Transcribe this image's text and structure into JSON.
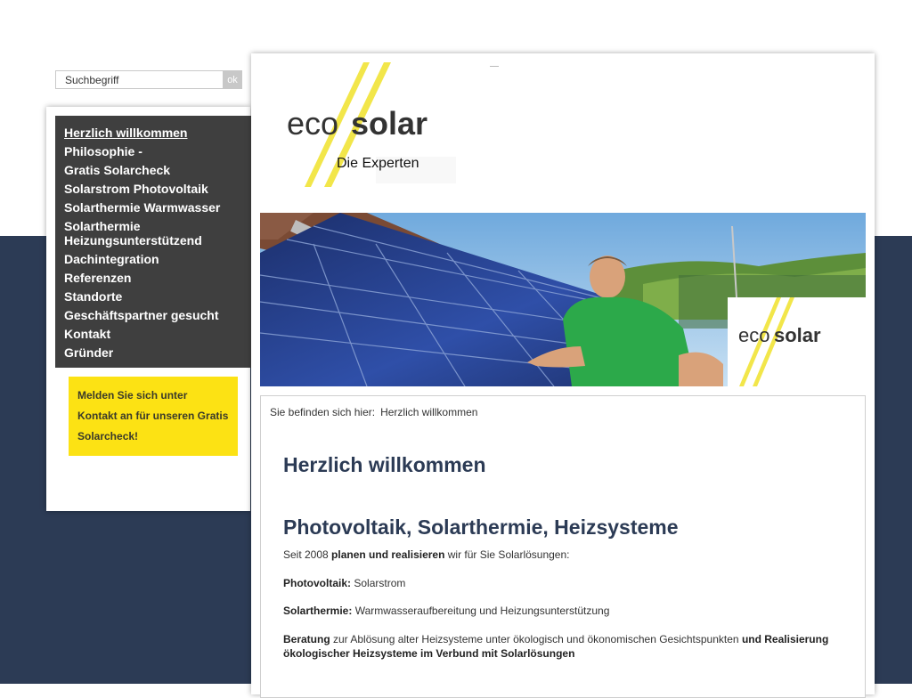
{
  "search": {
    "placeholder": "Suchbegriff",
    "button_label": "ok"
  },
  "nav": {
    "items": [
      {
        "label": "Herzlich willkommen",
        "active": true
      },
      {
        "label": "Philosophie -"
      },
      {
        "label": "Gratis Solarcheck"
      },
      {
        "label": "Solarstrom Photovoltaik"
      },
      {
        "label": "Solarthermie Warmwasser"
      },
      {
        "label": "Solarthermie Heizungsunterstützend"
      },
      {
        "label": "Dachintegration"
      },
      {
        "label": "Referenzen"
      },
      {
        "label": "Standorte"
      },
      {
        "label": "Geschäftspartner gesucht"
      },
      {
        "label": "Kontakt"
      },
      {
        "label": "Gründer"
      }
    ]
  },
  "promo": {
    "text": "Melden Sie sich unter Kontakt an für unseren Gratis Solarcheck!"
  },
  "logo": {
    "eco": "eco",
    "solar": "solar",
    "tagline": "Die Experten"
  },
  "hero": {
    "badge_eco": "eco",
    "badge_solar": "solar"
  },
  "breadcrumb": {
    "prefix": "Sie befinden sich hier:",
    "current": "Herzlich willkommen"
  },
  "content": {
    "title": "Herzlich willkommen",
    "subtitle": "Photovoltaik, Solarthermie, Heizsysteme",
    "intro": {
      "pre": "Seit 2008 ",
      "bold": "planen und realisieren",
      "post": " wir für Sie Solarlösungen:"
    },
    "pv": {
      "label": "Photovoltaik:",
      "text": " Solarstrom"
    },
    "st": {
      "label": "Solarthermie:",
      "text": " Warmwasseraufbereitung und Heizungsunterstützung"
    },
    "beratung": {
      "bold1": "Beratung",
      "text": " zur Ablösung alter Heizsysteme unter ökologisch und ökonomischen Gesichtspunkten ",
      "bold2": "und Realisierung ökologischer Heizsysteme im Verbund mit Solarlösungen"
    }
  },
  "colors": {
    "navy": "#2c3b55",
    "yellow": "#fce214",
    "nav_bg": "#3f3f3f",
    "sky": "#8fc0ea",
    "shirt": "#2ca94a"
  }
}
